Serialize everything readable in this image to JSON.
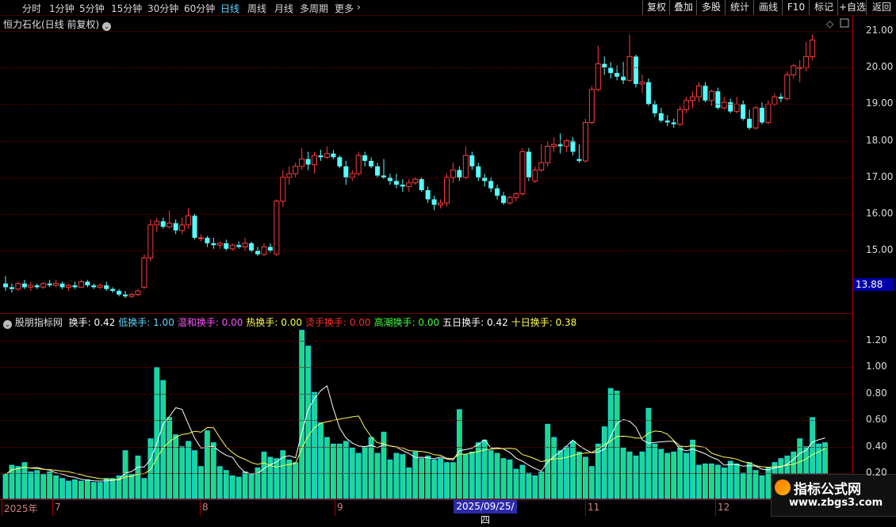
{
  "toolbar": {
    "periods": [
      "分时",
      "1分钟",
      "5分钟",
      "15分钟",
      "30分钟",
      "60分钟",
      "日线",
      "周线",
      "月线",
      "多周期",
      "更多"
    ],
    "active_period": "日线",
    "more_chevron": "›",
    "right_buttons": [
      "复权",
      "叠加",
      "多股",
      "统计",
      "画线",
      "F10",
      "标记",
      "+自选",
      "返回"
    ]
  },
  "main_chart": {
    "title": "恒力石化(日线 前复权)",
    "price_axis": [
      "21.00",
      "20.00",
      "19.00",
      "18.00",
      "17.00",
      "16.00",
      "15.00"
    ],
    "current_price": "13.88",
    "up_color": "#ff3c3c",
    "down_color": "#54ffff"
  },
  "indicator": {
    "name": "股朋指标网",
    "items": [
      {
        "label": "换手: 0.42",
        "color": "#ffffff"
      },
      {
        "label": "低换手: 1.00",
        "color": "#5fd7ff"
      },
      {
        "label": "温和换手: 0.00",
        "color": "#ff55ff"
      },
      {
        "label": "热换手: 0.00",
        "color": "#ffff55"
      },
      {
        "label": "烫手换手: 0.00",
        "color": "#ff3030"
      },
      {
        "label": "高潮换手: 0.00",
        "color": "#40ff40"
      },
      {
        "label": "五日换手: 0.42",
        "color": "#ffffff"
      },
      {
        "label": "十日换手: 0.38",
        "color": "#ffff55"
      }
    ],
    "axis": [
      "1.20",
      "1.00",
      "0.80",
      "0.60",
      "0.40",
      "0.20"
    ]
  },
  "date_axis": {
    "labels": [
      "2025年",
      "7",
      "8",
      "9",
      "11",
      "12"
    ],
    "selected": "2025/09/25/四"
  },
  "watermark": {
    "line1": "指标公式网",
    "line2": "www.zbgs3.com"
  },
  "chart_data": {
    "type": "candlestick",
    "candles": [
      [
        14.1,
        14.3,
        13.9,
        14.0
      ],
      [
        14.0,
        14.1,
        13.85,
        13.95
      ],
      [
        13.95,
        14.15,
        13.9,
        14.1
      ],
      [
        14.1,
        14.2,
        13.95,
        14.0
      ],
      [
        14.0,
        14.15,
        13.9,
        14.05
      ],
      [
        14.05,
        14.1,
        13.95,
        14.0
      ],
      [
        14.0,
        14.15,
        13.95,
        14.1
      ],
      [
        14.1,
        14.2,
        14.0,
        14.05
      ],
      [
        14.05,
        14.2,
        14.0,
        14.1
      ],
      [
        14.1,
        14.15,
        13.95,
        14.0
      ],
      [
        14.0,
        14.1,
        13.9,
        14.05
      ],
      [
        14.05,
        14.15,
        13.95,
        14.0
      ],
      [
        14.0,
        14.2,
        14.0,
        14.15
      ],
      [
        14.15,
        14.2,
        14.0,
        14.05
      ],
      [
        14.05,
        14.1,
        13.95,
        14.0
      ],
      [
        14.0,
        14.1,
        13.95,
        14.05
      ],
      [
        14.05,
        14.15,
        13.9,
        13.95
      ],
      [
        13.95,
        14.0,
        13.85,
        13.9
      ],
      [
        13.9,
        13.95,
        13.75,
        13.8
      ],
      [
        13.8,
        13.9,
        13.7,
        13.75
      ],
      [
        13.75,
        13.85,
        13.7,
        13.8
      ],
      [
        13.8,
        13.95,
        13.75,
        13.9
      ],
      [
        14.0,
        14.9,
        13.95,
        14.8
      ],
      [
        14.8,
        15.85,
        14.7,
        15.7
      ],
      [
        15.7,
        15.9,
        15.5,
        15.8
      ],
      [
        15.8,
        15.9,
        15.6,
        15.65
      ],
      [
        15.65,
        16.1,
        15.6,
        15.75
      ],
      [
        15.75,
        15.85,
        15.45,
        15.55
      ],
      [
        15.55,
        15.9,
        15.45,
        15.7
      ],
      [
        15.7,
        16.15,
        15.6,
        15.95
      ],
      [
        15.95,
        16.0,
        15.3,
        15.35
      ],
      [
        15.35,
        15.45,
        15.25,
        15.35
      ],
      [
        15.35,
        15.4,
        15.1,
        15.2
      ],
      [
        15.2,
        15.35,
        15.05,
        15.15
      ],
      [
        15.15,
        15.25,
        15.05,
        15.2
      ],
      [
        15.2,
        15.3,
        15.0,
        15.05
      ],
      [
        15.05,
        15.2,
        15.0,
        15.15
      ],
      [
        15.15,
        15.25,
        15.05,
        15.1
      ],
      [
        15.1,
        15.35,
        15.0,
        15.2
      ],
      [
        15.2,
        15.25,
        14.95,
        15.0
      ],
      [
        15.0,
        15.1,
        14.85,
        14.9
      ],
      [
        14.9,
        15.2,
        14.85,
        15.1
      ],
      [
        15.1,
        15.2,
        14.95,
        15.0
      ],
      [
        14.9,
        16.4,
        14.85,
        16.35
      ],
      [
        16.35,
        17.2,
        16.2,
        17.0
      ],
      [
        17.0,
        17.3,
        16.8,
        17.1
      ],
      [
        17.1,
        17.4,
        17.0,
        17.3
      ],
      [
        17.3,
        17.8,
        17.2,
        17.5
      ],
      [
        17.5,
        17.7,
        17.2,
        17.35
      ],
      [
        17.35,
        17.7,
        17.1,
        17.6
      ],
      [
        17.6,
        17.75,
        17.45,
        17.55
      ],
      [
        17.55,
        17.85,
        17.5,
        17.65
      ],
      [
        17.65,
        17.75,
        17.5,
        17.55
      ],
      [
        17.55,
        17.6,
        17.25,
        17.3
      ],
      [
        17.3,
        17.45,
        16.8,
        17.0
      ],
      [
        17.0,
        17.2,
        16.9,
        17.1
      ],
      [
        17.1,
        17.7,
        17.05,
        17.6
      ],
      [
        17.6,
        17.7,
        17.3,
        17.45
      ],
      [
        17.45,
        17.55,
        17.25,
        17.3
      ],
      [
        17.3,
        17.4,
        17.0,
        17.05
      ],
      [
        17.05,
        17.5,
        16.95,
        17.0
      ],
      [
        17.0,
        17.1,
        16.8,
        16.9
      ],
      [
        16.9,
        17.1,
        16.7,
        16.8
      ],
      [
        16.8,
        16.95,
        16.6,
        16.75
      ],
      [
        16.75,
        16.95,
        16.6,
        16.85
      ],
      [
        16.85,
        17.0,
        16.8,
        16.95
      ],
      [
        16.95,
        17.0,
        16.6,
        16.65
      ],
      [
        16.65,
        16.75,
        16.3,
        16.4
      ],
      [
        16.4,
        16.5,
        16.1,
        16.25
      ],
      [
        16.25,
        16.4,
        16.15,
        16.3
      ],
      [
        16.3,
        17.1,
        16.2,
        17.0
      ],
      [
        17.0,
        17.4,
        16.85,
        17.2
      ],
      [
        17.2,
        17.3,
        16.9,
        17.0
      ],
      [
        17.0,
        17.85,
        16.95,
        17.6
      ],
      [
        17.6,
        17.7,
        17.2,
        17.3
      ],
      [
        17.3,
        17.4,
        16.9,
        17.0
      ],
      [
        17.0,
        17.1,
        16.75,
        16.9
      ],
      [
        16.9,
        17.0,
        16.6,
        16.7
      ],
      [
        16.7,
        16.8,
        16.4,
        16.5
      ],
      [
        16.5,
        16.6,
        16.25,
        16.3
      ],
      [
        16.3,
        16.5,
        16.25,
        16.45
      ],
      [
        16.45,
        16.6,
        16.35,
        16.55
      ],
      [
        16.55,
        17.8,
        16.5,
        17.7
      ],
      [
        17.7,
        17.8,
        16.9,
        17.0
      ],
      [
        16.9,
        17.3,
        16.85,
        17.2
      ],
      [
        17.2,
        17.9,
        17.15,
        17.4
      ],
      [
        17.4,
        18.0,
        17.3,
        17.85
      ],
      [
        17.85,
        18.1,
        17.7,
        17.9
      ],
      [
        17.9,
        18.2,
        17.65,
        17.85
      ],
      [
        17.85,
        18.05,
        17.7,
        18.0
      ],
      [
        18.0,
        18.1,
        17.6,
        17.7
      ],
      [
        17.5,
        17.9,
        17.4,
        17.45
      ],
      [
        17.45,
        18.6,
        17.4,
        18.5
      ],
      [
        18.5,
        19.5,
        18.45,
        19.4
      ],
      [
        19.4,
        20.6,
        19.35,
        20.1
      ],
      [
        20.1,
        20.3,
        19.8,
        20.0
      ],
      [
        20.0,
        20.15,
        19.7,
        19.85
      ],
      [
        19.85,
        20.05,
        19.65,
        19.75
      ],
      [
        19.75,
        20.15,
        19.55,
        19.65
      ],
      [
        19.65,
        20.9,
        19.6,
        20.3
      ],
      [
        20.3,
        20.35,
        19.45,
        19.55
      ],
      [
        19.55,
        19.8,
        19.3,
        19.6
      ],
      [
        19.6,
        19.7,
        18.95,
        19.0
      ],
      [
        19.0,
        19.1,
        18.65,
        18.75
      ],
      [
        18.75,
        18.9,
        18.5,
        18.55
      ],
      [
        18.55,
        18.7,
        18.4,
        18.5
      ],
      [
        18.5,
        18.6,
        18.35,
        18.45
      ],
      [
        18.45,
        18.95,
        18.4,
        18.85
      ],
      [
        18.85,
        19.2,
        18.75,
        19.1
      ],
      [
        19.1,
        19.35,
        18.9,
        19.2
      ],
      [
        19.2,
        19.6,
        19.05,
        19.5
      ],
      [
        19.5,
        19.6,
        19.05,
        19.1
      ],
      [
        19.1,
        19.4,
        18.95,
        19.35
      ],
      [
        19.35,
        19.45,
        18.85,
        18.9
      ],
      [
        18.9,
        19.2,
        18.85,
        19.05
      ],
      [
        19.05,
        19.15,
        18.75,
        18.8
      ],
      [
        18.8,
        19.2,
        18.75,
        19.0
      ],
      [
        19.0,
        19.1,
        18.55,
        18.6
      ],
      [
        18.6,
        18.85,
        18.3,
        18.35
      ],
      [
        18.35,
        18.95,
        18.3,
        18.9
      ],
      [
        18.9,
        19.05,
        18.45,
        18.5
      ],
      [
        18.5,
        19.1,
        18.45,
        19.0
      ],
      [
        19.0,
        19.3,
        18.95,
        19.2
      ],
      [
        19.2,
        19.3,
        19.05,
        19.15
      ],
      [
        19.15,
        19.9,
        19.1,
        19.8
      ],
      [
        19.8,
        20.1,
        19.7,
        20.05
      ],
      [
        20.0,
        20.2,
        19.6,
        20.0
      ],
      [
        20.0,
        20.7,
        19.9,
        20.3
      ],
      [
        20.3,
        20.9,
        20.2,
        20.75
      ]
    ],
    "turnover": [
      0.19,
      0.26,
      0.25,
      0.28,
      0.21,
      0.22,
      0.19,
      0.21,
      0.18,
      0.16,
      0.14,
      0.15,
      0.14,
      0.15,
      0.13,
      0.13,
      0.16,
      0.16,
      0.18,
      0.37,
      0.19,
      0.33,
      0.16,
      0.46,
      1.0,
      0.9,
      0.62,
      0.49,
      0.4,
      0.44,
      0.37,
      0.25,
      0.52,
      0.43,
      0.25,
      0.22,
      0.18,
      0.17,
      0.21,
      0.19,
      0.24,
      0.36,
      0.32,
      0.31,
      0.37,
      0.3,
      0.28,
      1.28,
      1.16,
      0.81,
      0.58,
      0.47,
      0.42,
      0.42,
      0.44,
      0.39,
      0.35,
      0.4,
      0.47,
      0.35,
      0.51,
      0.3,
      0.35,
      0.34,
      0.24,
      0.36,
      0.31,
      0.33,
      0.3,
      0.31,
      0.28,
      0.28,
      0.68,
      0.34,
      0.36,
      0.43,
      0.45,
      0.37,
      0.35,
      0.31,
      0.3,
      0.23,
      0.26,
      0.2,
      0.18,
      0.21,
      0.57,
      0.47,
      0.37,
      0.4,
      0.44,
      0.36,
      0.32,
      0.25,
      0.42,
      0.55,
      0.84,
      0.82,
      0.39,
      0.36,
      0.33,
      0.36,
      0.69,
      0.42,
      0.38,
      0.35,
      0.36,
      0.4,
      0.35,
      0.45,
      0.26,
      0.27,
      0.27,
      0.26,
      0.24,
      0.29,
      0.27,
      0.2,
      0.28,
      0.22,
      0.18,
      0.24,
      0.28,
      0.31,
      0.33,
      0.36,
      0.46,
      0.4,
      0.62,
      0.42,
      0.43
    ]
  }
}
